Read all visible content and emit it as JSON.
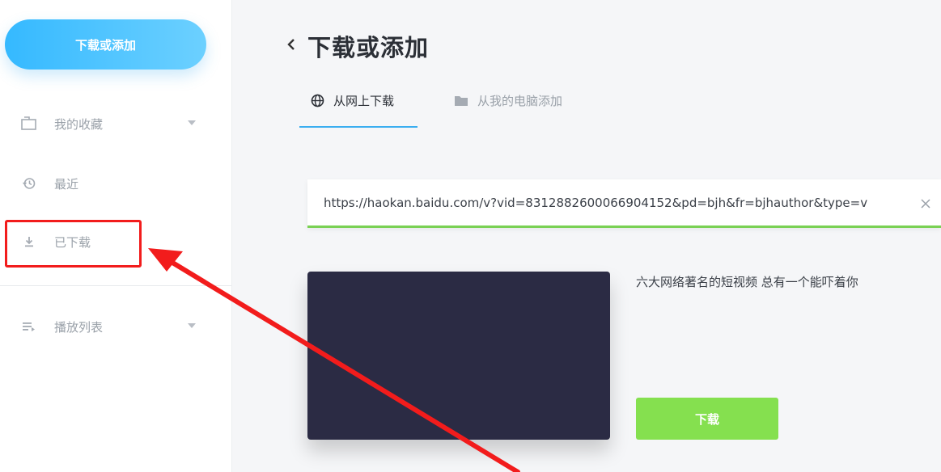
{
  "sidebar": {
    "primary_button": "下载或添加",
    "items": [
      {
        "label": "我的收藏",
        "icon": "folder-icon"
      },
      {
        "label": "最近",
        "icon": "history-icon"
      },
      {
        "label": "已下载",
        "icon": "download-icon"
      },
      {
        "label": "播放列表",
        "icon": "playlist-icon"
      }
    ]
  },
  "main": {
    "title": "下载或添加",
    "tabs": [
      {
        "label": "从网上下载",
        "icon": "globe-icon",
        "active": true
      },
      {
        "label": "从我的电脑添加",
        "icon": "folder-icon",
        "active": false
      }
    ],
    "url": {
      "value": "https://haokan.baidu.com/v?vid=8312882600066904152&pd=bjh&fr=bjhauthor&type=v"
    },
    "video": {
      "title": "六大网络著名的短视频 总有一个能吓着你"
    },
    "download_button": "下载"
  },
  "colors": {
    "accent_blue": "#35b9ff",
    "download_green": "#85e04f",
    "annotation_red": "#f21c1c",
    "thumbnail_bg": "#2b2b44"
  }
}
